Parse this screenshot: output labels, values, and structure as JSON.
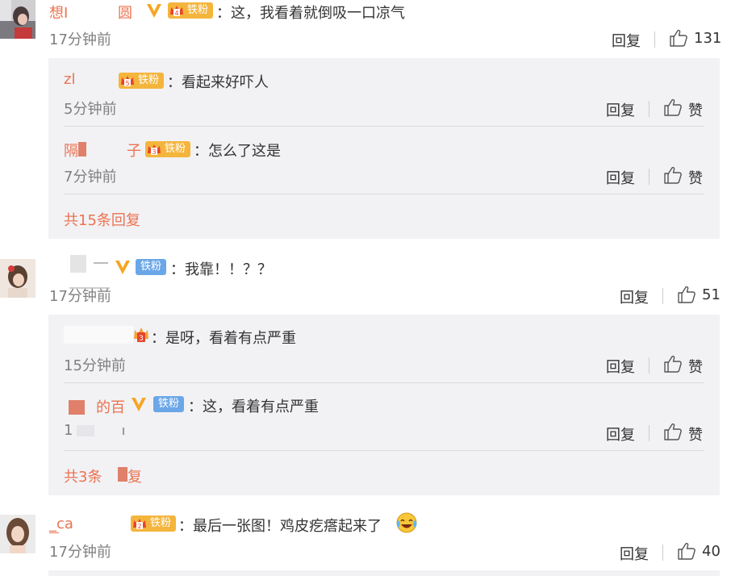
{
  "comments": [
    {
      "username": "想I",
      "username_tail": "圆",
      "badge": "铁粉",
      "badge_level": "4",
      "text": "：这，我看着就倒吸一口凉气",
      "time": "17分钟前",
      "reply_label": "回复",
      "likes": "131",
      "replies": [
        {
          "username": "zl",
          "badge": "铁粉",
          "badge_level": "5",
          "text": "：看起来好吓人",
          "time": "5分钟前",
          "reply_label": "回复",
          "like_label": "赞"
        },
        {
          "username": "隔",
          "username_tail": "子",
          "badge": "铁粉",
          "badge_level": "3",
          "text": "：怎么了这是",
          "time": "7分钟前",
          "reply_label": "回复",
          "like_label": "赞"
        }
      ],
      "more_replies": "共15条回复"
    },
    {
      "username": "",
      "badge": "铁粉",
      "text": "：我靠！！？？",
      "time": "17分钟前",
      "reply_label": "回复",
      "likes": "51",
      "replies": [
        {
          "username": "",
          "badge_level": "3",
          "text": "：是呀，看着有点严重",
          "time": "15分钟前",
          "reply_label": "回复",
          "like_label": "赞"
        },
        {
          "username": "的百",
          "badge": "铁粉",
          "text": "：这，看着有点严重",
          "time": "1",
          "reply_label": "回复",
          "like_label": "赞"
        }
      ],
      "more_replies_a": "共3条",
      "more_replies_b": "复"
    },
    {
      "username": "_ca",
      "badge": "铁粉",
      "badge_level": "2",
      "text": "：最后一张图！鸡皮疙瘩起来了",
      "emoji": "laugh-cry",
      "time": "17分钟前",
      "reply_label": "回复",
      "likes": "40"
    }
  ],
  "colors": {
    "link": "#eb7350",
    "text": "#333333",
    "meta": "#808080",
    "reply_bg": "#f2f2f5",
    "badge_gold": "#f4b53d",
    "badge_blue": "#6ba7e8",
    "verified": "#f5a623"
  },
  "icons": {
    "like": "thumbs-up-icon",
    "verified": "verified-v-icon",
    "crown": "fan-crown-icon"
  }
}
